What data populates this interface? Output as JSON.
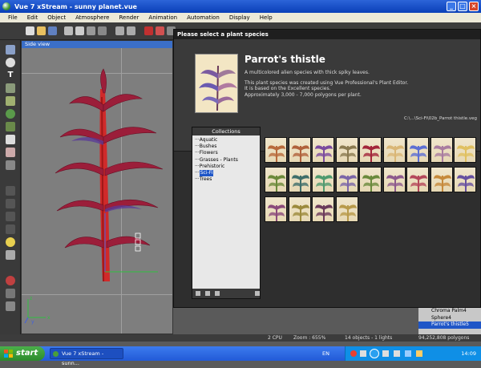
{
  "app": {
    "title": "Vue 7 xStream - sunny planet.vue",
    "window_buttons": [
      "_",
      "□",
      "×"
    ]
  },
  "menu": [
    "File",
    "Edit",
    "Object",
    "Atmosphere",
    "Render",
    "Animation",
    "Automation",
    "Display",
    "Help"
  ],
  "viewport": {
    "label": "Side view",
    "axis_x": "x",
    "axis_y": "y",
    "axis_z": "z"
  },
  "left_tools": [
    "T"
  ],
  "dialog": {
    "title": "Please select a plant species",
    "plant_name": "Parrot's thistle",
    "desc1": "A multicolored alien species with thick spiky leaves.",
    "desc2": "This plant species was created using Vue Professional's Plant Editor.",
    "desc3": "It is based on the Excellent species.",
    "desc4": "Approximately 3,000 - 7,000 polygons per plant.",
    "file": "C:\\...\\Sci-Fi\\02b_Parrot thistle.veg"
  },
  "collections": {
    "header": "Collections",
    "items": [
      "Aquatic",
      "Bushes",
      "Flowers",
      "Grasses - Plants",
      "Prehistoric",
      "Sci-Fi",
      "Trees"
    ],
    "selected": "Sci-Fi"
  },
  "thumbnail_colors": [
    "#b86a3c",
    "#b0613b",
    "#7a4a9e",
    "#8a7a50",
    "#a3263a",
    "#d9b676",
    "#5d6fd3",
    "#a97da0",
    "#e0c060",
    "#6c8a3a",
    "#3f6e6a",
    "#4f9a6f",
    "#7b66a8",
    "#6a8a3c",
    "#8d5a8d",
    "#b4475a",
    "#c68a3c",
    "#6650a0",
    "#8a4a7a",
    "#9c8a3c",
    "#6a3a5a",
    "#b89a4a"
  ],
  "right_panel": {
    "items": [
      "Chroma Palm4",
      "Sphere4",
      "Parrot's thistle5"
    ],
    "selected": "Parrot's thistle5"
  },
  "status": {
    "cpu": "2 CPU",
    "zoom": "Zoom : 655%",
    "objects": "14 objects - 1 lights",
    "polygons": "94,252,808 polygons"
  },
  "taskbar": {
    "start": "start",
    "task": "Vue 7 xStream - sunn...",
    "lang": "EN",
    "clock": "14:09"
  },
  "colors": {
    "title_blue": "#0a3fb8",
    "selection": "#1f56c7",
    "taskbar": "#225ad7",
    "start_green": "#2c8a2c"
  }
}
